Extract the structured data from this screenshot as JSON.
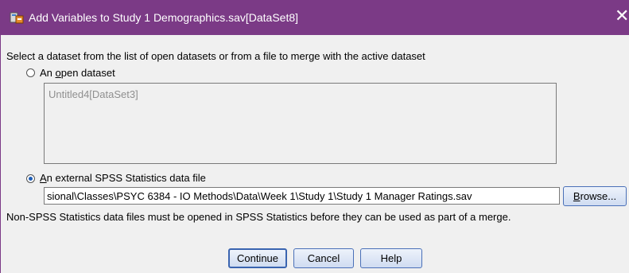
{
  "window": {
    "title": "Add Variables to Study 1 Demographics.sav[DataSet8]",
    "close_glyph": "✕"
  },
  "instructions": "Select a dataset from the list of open datasets or from a file to merge with the active dataset",
  "open_dataset": {
    "label_prefix": "An ",
    "label_mnemonic": "o",
    "label_rest": "pen dataset",
    "selected": false,
    "items": [
      "Untitled4[DataSet3]"
    ]
  },
  "external_file": {
    "label_mnemonic": "A",
    "label_rest": "n external SPSS Statistics data file",
    "selected": true,
    "path_value": "sional\\Classes\\PSYC 6384 - IO Methods\\Data\\Week 1\\Study 1\\Study 1 Manager Ratings.sav",
    "browse_mnemonic": "B",
    "browse_rest": "rowse..."
  },
  "note": "Non-SPSS Statistics data files must be opened in SPSS Statistics before they can be used as part of a merge.",
  "buttons": {
    "continue": "Continue",
    "cancel": "Cancel",
    "help": "Help"
  },
  "colors": {
    "titlebar": "#7b3a86",
    "button_border": "#4a70b8"
  }
}
